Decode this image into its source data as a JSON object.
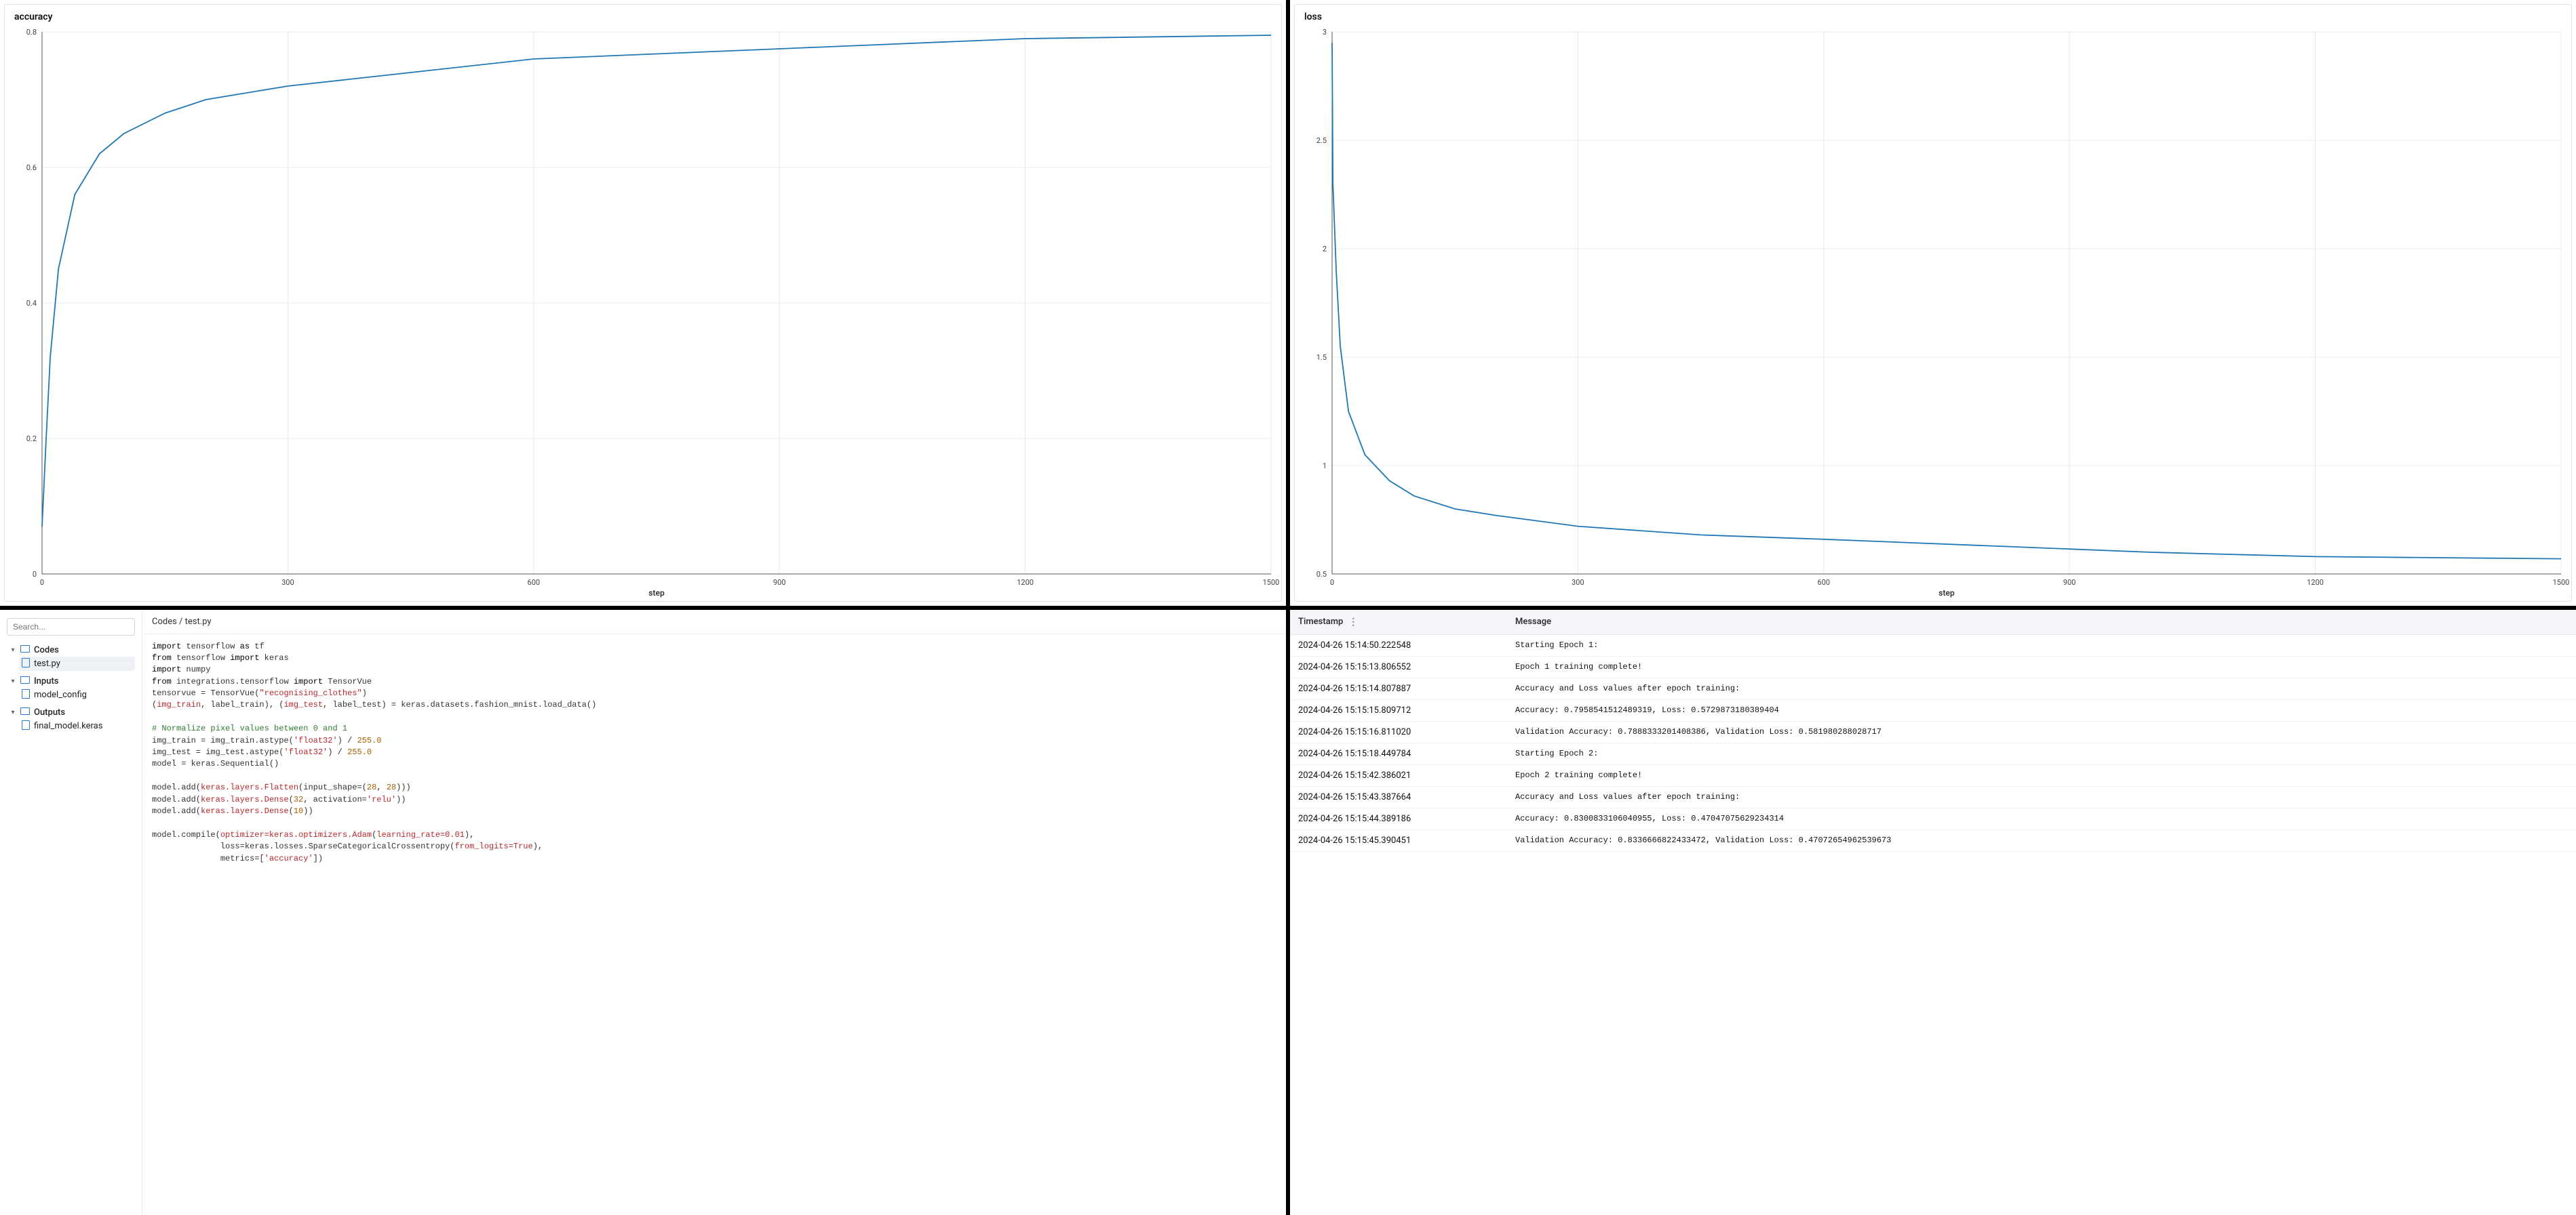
{
  "chart_data": [
    {
      "type": "line",
      "title": "accuracy",
      "xlabel": "step",
      "ylabel": "",
      "xlim": [
        0,
        1500
      ],
      "ylim": [
        0,
        0.8
      ],
      "xticks": [
        0,
        300,
        600,
        900,
        1200,
        1500
      ],
      "yticks": [
        0,
        0.2,
        0.4,
        0.6,
        0.8
      ],
      "x": [
        0,
        5,
        10,
        20,
        40,
        70,
        100,
        150,
        200,
        300,
        450,
        600,
        800,
        1000,
        1200,
        1500
      ],
      "values": [
        0.07,
        0.2,
        0.32,
        0.45,
        0.56,
        0.62,
        0.65,
        0.68,
        0.7,
        0.72,
        0.74,
        0.76,
        0.77,
        0.78,
        0.79,
        0.795
      ]
    },
    {
      "type": "line",
      "title": "loss",
      "xlabel": "step",
      "ylabel": "",
      "xlim": [
        0,
        1500
      ],
      "ylim": [
        0.5,
        3
      ],
      "xticks": [
        0,
        300,
        600,
        900,
        1200,
        1500
      ],
      "yticks": [
        0.5,
        1,
        1.5,
        2,
        2.5,
        3
      ],
      "x": [
        0,
        1,
        5,
        10,
        20,
        40,
        70,
        100,
        150,
        200,
        300,
        450,
        600,
        800,
        1000,
        1200,
        1500
      ],
      "values": [
        2.95,
        2.3,
        1.9,
        1.55,
        1.25,
        1.05,
        0.93,
        0.86,
        0.8,
        0.77,
        0.72,
        0.68,
        0.66,
        0.63,
        0.6,
        0.58,
        0.57
      ]
    }
  ],
  "sidebar": {
    "search_placeholder": "Search...",
    "sections": [
      {
        "name": "Codes",
        "open": true,
        "children": [
          {
            "name": "test.py",
            "selected": true
          }
        ]
      },
      {
        "name": "Inputs",
        "open": true,
        "children": [
          {
            "name": "model_config",
            "selected": false
          }
        ]
      },
      {
        "name": "Outputs",
        "open": true,
        "children": [
          {
            "name": "final_model.keras",
            "selected": false
          }
        ]
      }
    ]
  },
  "breadcrumb": "Codes / test.py",
  "code_raw": [
    "import tensorflow as tf",
    "from tensorflow import keras",
    "import numpy",
    "from integrations.tensorflow import TensorVue",
    "tensorvue = TensorVue(\"recognising_clothes\")",
    "(img_train, label_train), (img_test, label_test) = keras.datasets.fashion_mnist.load_data()",
    "",
    "# Normalize pixel values between 0 and 1",
    "img_train = img_train.astype('float32') / 255.0",
    "img_test = img_test.astype('float32') / 255.0",
    "model = keras.Sequential()",
    "",
    "model.add(keras.layers.Flatten(input_shape=(28, 28)))",
    "model.add(keras.layers.Dense(32, activation='relu'))",
    "model.add(keras.layers.Dense(10))",
    "",
    "model.compile(optimizer=keras.optimizers.Adam(learning_rate=0.01),",
    "              loss=keras.losses.SparseCategoricalCrossentropy(from_logits=True),",
    "              metrics=['accuracy'])"
  ],
  "code_highlighted": [
    [
      [
        "kw",
        "import"
      ],
      [
        "",
        " tensorflow "
      ],
      [
        "kw",
        "as"
      ],
      [
        "",
        " tf"
      ]
    ],
    [
      [
        "kw",
        "from"
      ],
      [
        "",
        " tensorflow "
      ],
      [
        "kw",
        "import"
      ],
      [
        "",
        " keras"
      ]
    ],
    [
      [
        "kw",
        "import"
      ],
      [
        "",
        " numpy"
      ]
    ],
    [
      [
        "kw",
        "from"
      ],
      [
        "",
        " integrations.tensorflow "
      ],
      [
        "kw",
        "import"
      ],
      [
        "",
        " TensorVue"
      ]
    ],
    [
      [
        "",
        "tensorvue = TensorVue("
      ],
      [
        "str",
        "\"recognising_clothes\""
      ],
      [
        "",
        ")"
      ]
    ],
    [
      [
        "",
        "("
      ],
      [
        "fn",
        "img_train"
      ],
      [
        "",
        ", label_train), ("
      ],
      [
        "fn",
        "img_test"
      ],
      [
        "",
        ", label_test) = keras.datasets.fashion_mnist.load_data()"
      ]
    ],
    [
      [
        "",
        ""
      ]
    ],
    [
      [
        "comment",
        "# Normalize pixel values between "
      ],
      [
        "green",
        "0"
      ],
      [
        "comment",
        " and "
      ],
      [
        "green",
        "1"
      ]
    ],
    [
      [
        "",
        "img_train = img_train.astype("
      ],
      [
        "str",
        "'float32'"
      ],
      [
        "",
        ") / "
      ],
      [
        "num",
        "255.0"
      ]
    ],
    [
      [
        "",
        "img_test = img_test.astype("
      ],
      [
        "str",
        "'float32'"
      ],
      [
        "",
        ") / "
      ],
      [
        "num",
        "255.0"
      ]
    ],
    [
      [
        "",
        "model = keras.Sequential()"
      ]
    ],
    [
      [
        "",
        ""
      ]
    ],
    [
      [
        "",
        "model.add("
      ],
      [
        "fn",
        "keras.layers.Flatten"
      ],
      [
        "",
        "(input_shape=("
      ],
      [
        "num",
        "28"
      ],
      [
        "",
        ", "
      ],
      [
        "num",
        "28"
      ],
      [
        "",
        "))"
      ],
      [
        "",
        ")"
      ]
    ],
    [
      [
        "",
        "model.add("
      ],
      [
        "fn",
        "keras.layers.Dense"
      ],
      [
        "",
        "("
      ],
      [
        "num",
        "32"
      ],
      [
        "",
        ", activation="
      ],
      [
        "str",
        "'relu'"
      ],
      [
        "",
        ")"
      ],
      [
        "",
        ")"
      ]
    ],
    [
      [
        "",
        "model.add("
      ],
      [
        "fn",
        "keras.layers.Dense"
      ],
      [
        "",
        "("
      ],
      [
        "num",
        "10"
      ],
      [
        "",
        ")"
      ],
      [
        "",
        ")"
      ]
    ],
    [
      [
        "",
        ""
      ]
    ],
    [
      [
        "",
        "model.compile("
      ],
      [
        "fn",
        "optimizer=keras.optimizers.Adam"
      ],
      [
        "",
        "("
      ],
      [
        "fn",
        "learning_rate=0.01"
      ],
      [
        "",
        "),"
      ]
    ],
    [
      [
        "",
        "              loss=keras.losses.SparseCategoricalCrossentropy("
      ],
      [
        "fn",
        "from_logits=True"
      ],
      [
        "",
        "),"
      ]
    ],
    [
      [
        "",
        "              metrics=["
      ],
      [
        "str",
        "'accuracy'"
      ],
      [
        "",
        "])"
      ]
    ]
  ],
  "log": {
    "headers": {
      "ts": "Timestamp",
      "msg": "Message"
    },
    "rows": [
      {
        "ts": "2024-04-26 15:14:50.222548",
        "msg": "Starting Epoch 1:"
      },
      {
        "ts": "2024-04-26 15:15:13.806552",
        "msg": "Epoch 1 training complete!"
      },
      {
        "ts": "2024-04-26 15:15:14.807887",
        "msg": "Accuracy and Loss values after epoch training:"
      },
      {
        "ts": "2024-04-26 15:15:15.809712",
        "msg": "Accuracy: 0.7958541512489319, Loss: 0.5729873180389404"
      },
      {
        "ts": "2024-04-26 15:15:16.811020",
        "msg": "Validation Accuracy: 0.7888333201408386, Validation Loss: 0.581980288028717"
      },
      {
        "ts": "2024-04-26 15:15:18.449784",
        "msg": "Starting Epoch 2:"
      },
      {
        "ts": "2024-04-26 15:15:42.386021",
        "msg": "Epoch 2 training complete!"
      },
      {
        "ts": "2024-04-26 15:15:43.387664",
        "msg": "Accuracy and Loss values after epoch training:"
      },
      {
        "ts": "2024-04-26 15:15:44.389186",
        "msg": "Accuracy: 0.8300833106040955, Loss: 0.47047075629234314"
      },
      {
        "ts": "2024-04-26 15:15:45.390451",
        "msg": "Validation Accuracy: 0.8336666822433472, Validation Loss: 0.47072654962539673"
      }
    ]
  }
}
